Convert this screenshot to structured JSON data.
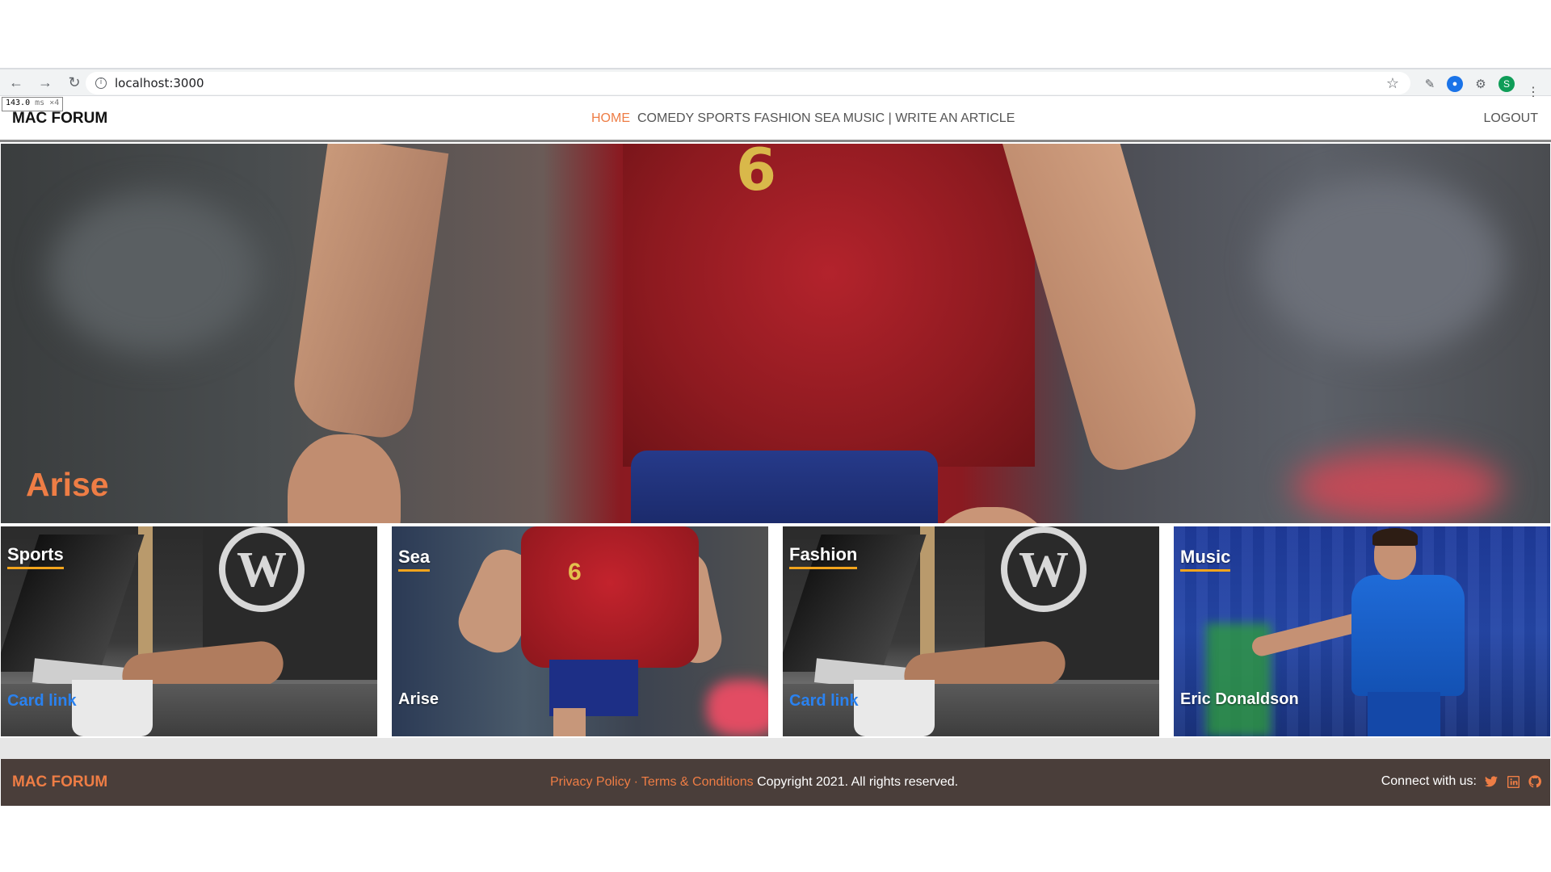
{
  "browser": {
    "url": "localhost:3000",
    "perf_value": "143.0",
    "perf_unit": "ms",
    "perf_count": "×4",
    "avatar_letter": "S"
  },
  "header": {
    "brand": "MAC FORUM",
    "menu_home": "HOME",
    "menu_rest": "COMEDY SPORTS FASHION SEA MUSIC | WRITE AN ARTICLE",
    "logout": "LOGOUT"
  },
  "hero": {
    "title": "Arise"
  },
  "cards": [
    {
      "category": "Sports",
      "footer": "Card link",
      "image": "wordpress-desk"
    },
    {
      "category": "Sea",
      "footer": "Arise",
      "image": "spain-player"
    },
    {
      "category": "Fashion",
      "footer": "Card link",
      "image": "wordpress-desk"
    },
    {
      "category": "Music",
      "footer": "Eric Donaldson",
      "image": "getafe-player"
    }
  ],
  "footer": {
    "brand": "MAC FORUM",
    "privacy": "Privacy Policy",
    "separator": "·",
    "terms": "Terms & Conditions",
    "copyright": "Copyright 2021. All rights reserved.",
    "connect": "Connect with us:",
    "icons": [
      "twitter-icon",
      "linkedin-icon",
      "github-icon"
    ]
  },
  "colors": {
    "accent": "#ee7d45",
    "link": "#2a82f0",
    "underline": "#f2a41c",
    "footer_bg": "#4a3e3a"
  }
}
